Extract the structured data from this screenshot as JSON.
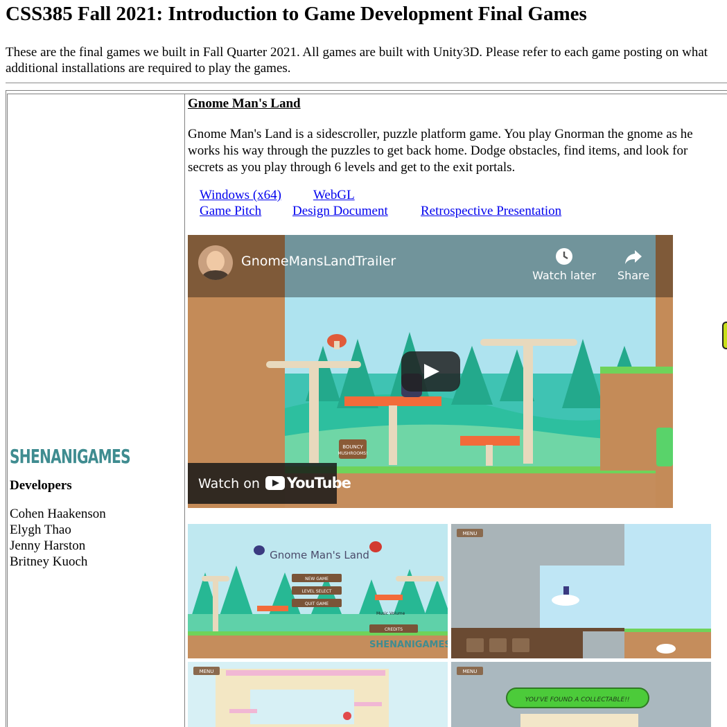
{
  "page": {
    "title": "CSS385 Fall 2021: Introduction to Game Development Final Games",
    "intro": "These are the final games we built in Fall Quarter 2021. All games are built with Unity3D. Please refer to each game posting on what additional installations are required to play the games."
  },
  "team": {
    "logo_text": "SHENANIGAMES",
    "developers_heading": "Developers",
    "developers": [
      "Cohen Haakenson",
      "Elygh Thao",
      "Jenny Harston",
      "Britney Kuoch"
    ]
  },
  "game": {
    "title": "Gnome Man's Land",
    "description": "Gnome Man's Land is a sidescroller, puzzle platform game. You play Gnorman the gnome as he works his way through the puzzles to get back home. Dodge obstacles, find items, and look for secrets as you play through 6 levels and get to the exit portals.",
    "links": {
      "windows": "Windows (x64)",
      "webgl": "WebGL",
      "pitch": "Game Pitch",
      "design": "Design Document",
      "retro": "Retrospective Presentation"
    }
  },
  "video": {
    "title": "GnomeMansLandTrailer",
    "watch_later": "Watch later",
    "share": "Share",
    "watch_on": "Watch on",
    "youtube": "YouTube",
    "sign_text": "BOUNCY MUSHROOMS!"
  },
  "screenshots": {
    "menu_title": "Gnome Man's Land",
    "new_game": "NEW GAME",
    "level_select": "LEVEL SELECT",
    "quit_game": "QUIT GAME",
    "music_volume": "Music Volume",
    "credits": "CREDITS",
    "studio": "SHENANIGAMES",
    "menu_btn": "MENU",
    "collectable": "YOU'VE FOUND A COLLECTABLE!!"
  }
}
